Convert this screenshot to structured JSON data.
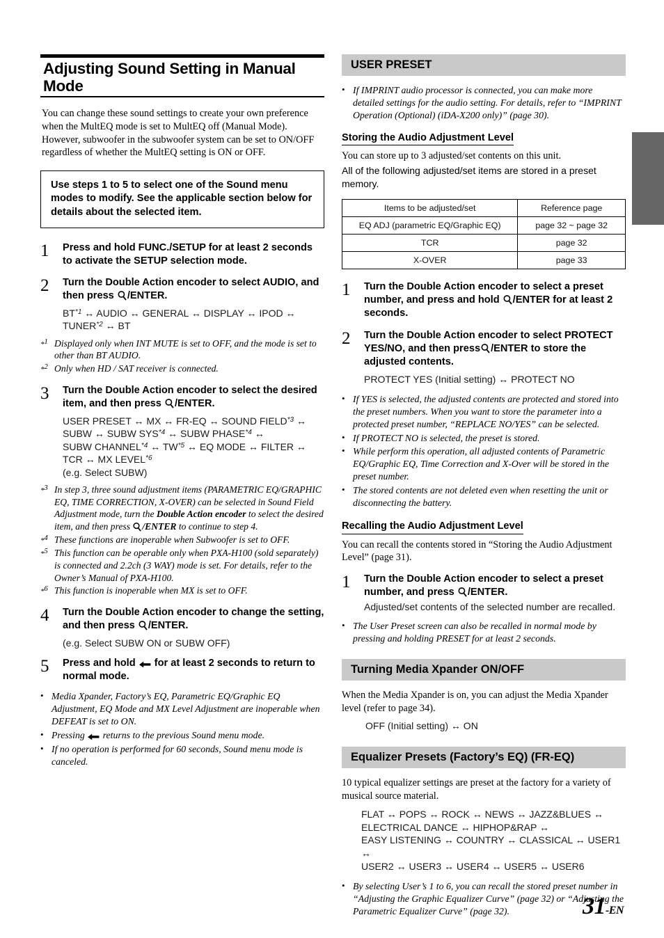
{
  "page": {
    "number": "31",
    "number_suffix": "-EN"
  },
  "left": {
    "chapter_title": "Adjusting Sound Setting in Manual Mode",
    "intro": "You can change these sound settings to create your own preference when the MultEQ mode is set to MultEQ off (Manual Mode). However, subwoofer in the subwoofer system can be set to ON/OFF regardless of whether the MultEQ setting is ON or OFF.",
    "callout": "Use steps 1 to 5 to select one of the Sound menu modes to modify. See the applicable section below for details about the selected item.",
    "steps": [
      {
        "num": "1",
        "head_pre": "Press and hold ",
        "head_bold": "FUNC./SETUP",
        "head_post": " for at least 2 seconds to activate the SETUP selection mode."
      },
      {
        "num": "2",
        "head_pre": "Turn the ",
        "head_bold": "Double Action encoder",
        "head_post": " to select AUDIO, and then press ",
        "head_icon": "magnifier-icon",
        "head_tail": "/ENTER.",
        "sub_line1": "BT*1 ↔ AUDIO ↔ GENERAL ↔ DISPLAY ↔ IPOD ↔",
        "sub_line2": "TUNER*2 ↔ BT"
      },
      {
        "num": "3",
        "head_pre": "Turn the ",
        "head_bold": "Double Action encoder",
        "head_post": " to select the desired item, and then press ",
        "head_icon": "magnifier-icon",
        "head_tail": "/ENTER.",
        "sub_line1": "USER PRESET ↔ MX ↔ FR-EQ ↔ SOUND FIELD*3 ↔",
        "sub_line2": "SUBW ↔ SUBW SYS*4 ↔ SUBW PHASE*4 ↔",
        "sub_line3": "SUBW CHANNEL*4 ↔ TW*5 ↔ EQ MODE ↔ FILTER ↔",
        "sub_line4": "TCR ↔ MX LEVEL*6",
        "sub_line5": "(e.g. Select SUBW)"
      },
      {
        "num": "4",
        "head_pre": "Turn the ",
        "head_bold": "Double Action encoder",
        "head_post": " to change the setting, and then press ",
        "head_icon": "magnifier-icon",
        "head_tail": "/ENTER.",
        "sub_line1": "(e.g. Select SUBW ON or SUBW OFF)"
      },
      {
        "num": "5",
        "head_pre": "Press and hold ",
        "head_icon": "return-arrow-icon",
        "head_post": " for at least 2 seconds to return to normal mode."
      }
    ],
    "footnotes_a": [
      {
        "mark": "1",
        "text": "Displayed only when INT MUTE is set to OFF, and the mode is set to other than BT AUDIO."
      },
      {
        "mark": "2",
        "text": "Only when HD / SAT receiver is connected."
      }
    ],
    "footnotes_b": [
      {
        "mark": "3",
        "text_pre": "In step 3, three sound adjustment items (PARAMETRIC EQ/GRAPHIC EQ, TIME CORRECTION, X-OVER) can be selected in Sound Field Adjustment mode, turn the ",
        "text_bold": "Double Action encoder",
        "text_mid": " to select the desired item, and then press ",
        "text_icon": "magnifier-icon",
        "text_bold2": "/ENTER",
        "text_post": " to continue to step 4."
      },
      {
        "mark": "4",
        "text": "These functions are inoperable when Subwoofer is set to OFF."
      },
      {
        "mark": "5",
        "text": "This function can be operable only when PXA-H100 (sold separately) is connected and 2.2ch (3 WAY) mode is set. For details, refer to the Owner’s Manual of PXA-H100."
      },
      {
        "mark": "6",
        "text": "This function is inoperable when MX is set to OFF."
      }
    ],
    "bullets": [
      {
        "text": "Media Xpander, Factory’s EQ, Parametric EQ/Graphic EQ Adjustment, EQ Mode and MX Level Adjustment are inoperable when DEFEAT is set to ON."
      },
      {
        "text_pre": "Pressing ",
        "icon": "return-arrow-icon",
        "text_post": " returns to the previous Sound menu mode."
      },
      {
        "text": "If no operation is performed for 60 seconds, Sound menu mode is canceled."
      }
    ]
  },
  "right": {
    "section_user_preset": "USER PRESET",
    "user_preset_note": "If IMPRINT audio processor is connected, you can make more detailed settings for the audio setting. For details, refer to “IMPRINT Operation (Optional) (iDA-X200 only)” (page 30).",
    "storing_head": "Storing the Audio Adjustment Level",
    "storing_line1": "You can store up to 3 adjusted/set contents on this unit.",
    "storing_line2": "All of the following adjusted/set items are stored in a preset memory.",
    "table": {
      "headers": [
        "Items to be adjusted/set",
        "Reference page"
      ],
      "rows": [
        [
          "EQ ADJ (parametric EQ/Graphic EQ)",
          "page 32 ~ page 32"
        ],
        [
          "TCR",
          "page 32"
        ],
        [
          "X-OVER",
          "page 33"
        ]
      ]
    },
    "storing_steps": [
      {
        "num": "1",
        "head_pre": "Turn the ",
        "head_bold": "Double Action encoder",
        "head_post": " to select a preset number, and press and hold ",
        "head_icon": "magnifier-icon",
        "head_bold2": "/ENTER",
        "head_tail": " for at least 2 seconds."
      },
      {
        "num": "2",
        "head_pre": "Turn the ",
        "head_bold": "Double Action encoder",
        "head_post": " to select PROTECT YES/NO, and then press",
        "head_icon": "magnifier-icon",
        "head_bold2": "/ENTER",
        "head_tail": " to store the adjusted contents.",
        "sub_line1": "PROTECT YES (Initial setting) ↔ PROTECT NO"
      }
    ],
    "storing_bullets": [
      "If YES is selected, the adjusted contents are protected and stored into the preset numbers. When you want to store the parameter into a protected preset number, “REPLACE NO/YES” can be selected.",
      "If PROTECT NO is selected, the preset is stored.",
      "While perform this operation, all adjusted contents of Parametric EQ/Graphic EQ, Time Correction and X-Over will be stored in the preset number.",
      "The stored contents are not deleted even when resetting the unit or disconnecting the battery."
    ],
    "recalling_head": "Recalling the Audio Adjustment Level",
    "recalling_body": "You can recall the contents stored in “Storing the Audio Adjustment Level” (page 31).",
    "recalling_step": {
      "num": "1",
      "head_pre": "Turn the ",
      "head_bold": "Double Action encoder",
      "head_post": " to select a preset number, and press ",
      "head_icon": "magnifier-icon",
      "head_tail": "/ENTER.",
      "sub_line1": "Adjusted/set contents of the selected number are recalled."
    },
    "recalling_bullet": "The User Preset screen can also be recalled in normal mode by pressing and holding PRESET for at least 2 seconds.",
    "section_media_xpander": "Turning Media Xpander ON/OFF",
    "media_xpander_body": "When the Media Xpander is on, you can adjust the Media Xpander level (refer to page 34).",
    "media_xpander_options": "OFF (Initial setting) ↔ ON",
    "section_eq_presets": "Equalizer Presets (Factory’s EQ) (FR-EQ)",
    "eq_presets_body": "10 typical equalizer settings are preset at the factory for a variety of musical source material.",
    "eq_presets_lines": [
      "FLAT ↔ POPS ↔ ROCK ↔ NEWS ↔ JAZZ&BLUES ↔",
      "ELECTRICAL DANCE ↔ HIPHOP&RAP ↔",
      "EASY LISTENING ↔ COUNTRY ↔ CLASSICAL ↔ USER1 ↔",
      "USER2 ↔ USER3 ↔ USER4 ↔ USER5 ↔ USER6"
    ],
    "eq_presets_bullet": "By selecting User’s 1 to 6, you can recall the stored preset number in “Adjusting the Graphic Equalizer Curve” (page 32) or “Adjusting the Parametric Equalizer Curve” (page 32)."
  },
  "colors": {
    "section_bar": "#c9c9c9",
    "side_tab": "#666666"
  }
}
